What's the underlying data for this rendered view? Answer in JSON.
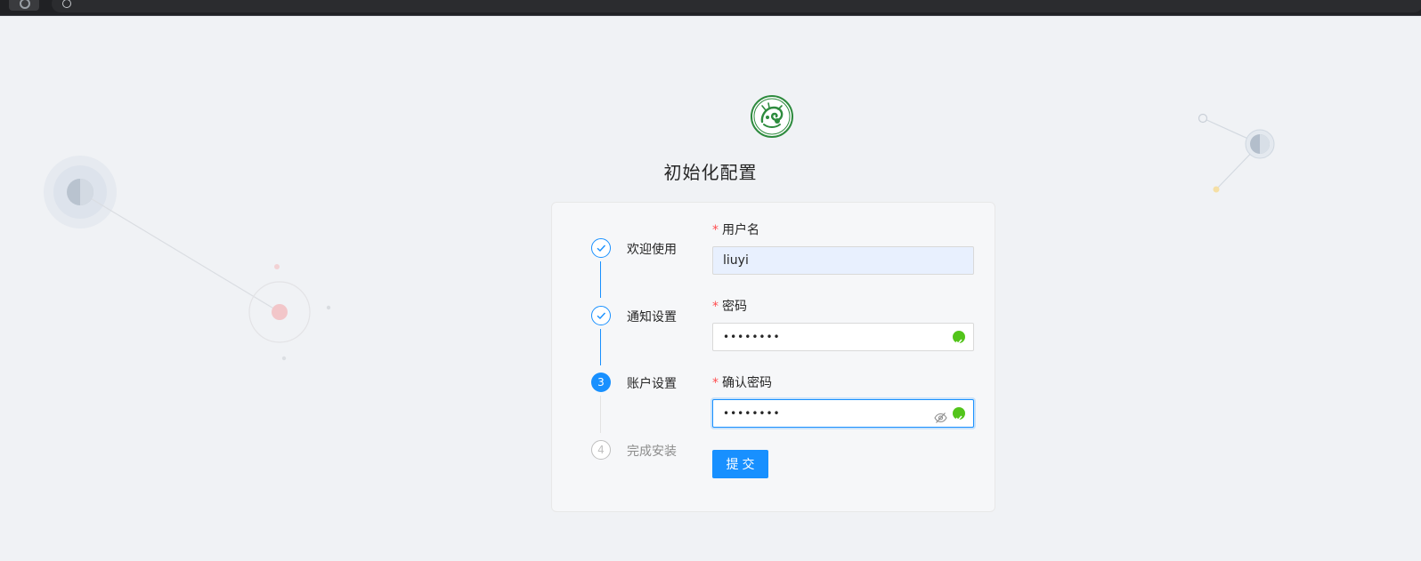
{
  "page": {
    "title": "初始化配置",
    "logo_icon": "dragon-emblem-icon"
  },
  "steps": [
    {
      "label": "欢迎使用",
      "status": "finished",
      "marker": ""
    },
    {
      "label": "通知设置",
      "status": "finished",
      "marker": ""
    },
    {
      "label": "账户设置",
      "status": "active",
      "marker": "3"
    },
    {
      "label": "完成安装",
      "status": "waiting",
      "marker": "4"
    }
  ],
  "form": {
    "required_mark": "*",
    "username": {
      "label": "用户名",
      "value": "liuyi"
    },
    "password": {
      "label": "密码",
      "value": "••••••••",
      "valid": true
    },
    "confirm_password": {
      "label": "确认密码",
      "value": "••••••••",
      "valid": true,
      "visibility_icon": "eye-off-icon"
    },
    "submit_label": "提交"
  },
  "colors": {
    "primary": "#1890ff",
    "success": "#52c41a",
    "required": "#ff4d4f",
    "logo_green": "#2e8b3e"
  }
}
